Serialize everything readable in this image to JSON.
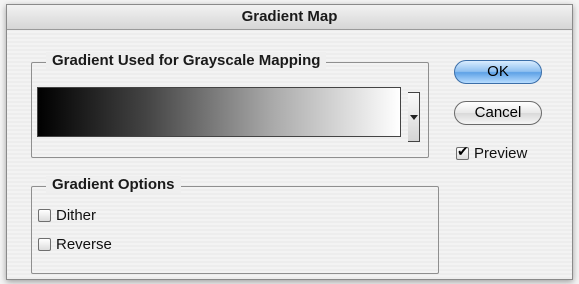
{
  "window": {
    "title": "Gradient Map"
  },
  "gradient_group": {
    "legend": "Gradient Used for Grayscale Mapping",
    "colors": [
      "#000000",
      "#ffffff"
    ]
  },
  "options_group": {
    "legend": "Gradient Options",
    "dither": {
      "label": "Dither",
      "checked": false
    },
    "reverse": {
      "label": "Reverse",
      "checked": false
    }
  },
  "buttons": {
    "ok": "OK",
    "cancel": "Cancel"
  },
  "preview": {
    "label": "Preview",
    "checked": true
  }
}
